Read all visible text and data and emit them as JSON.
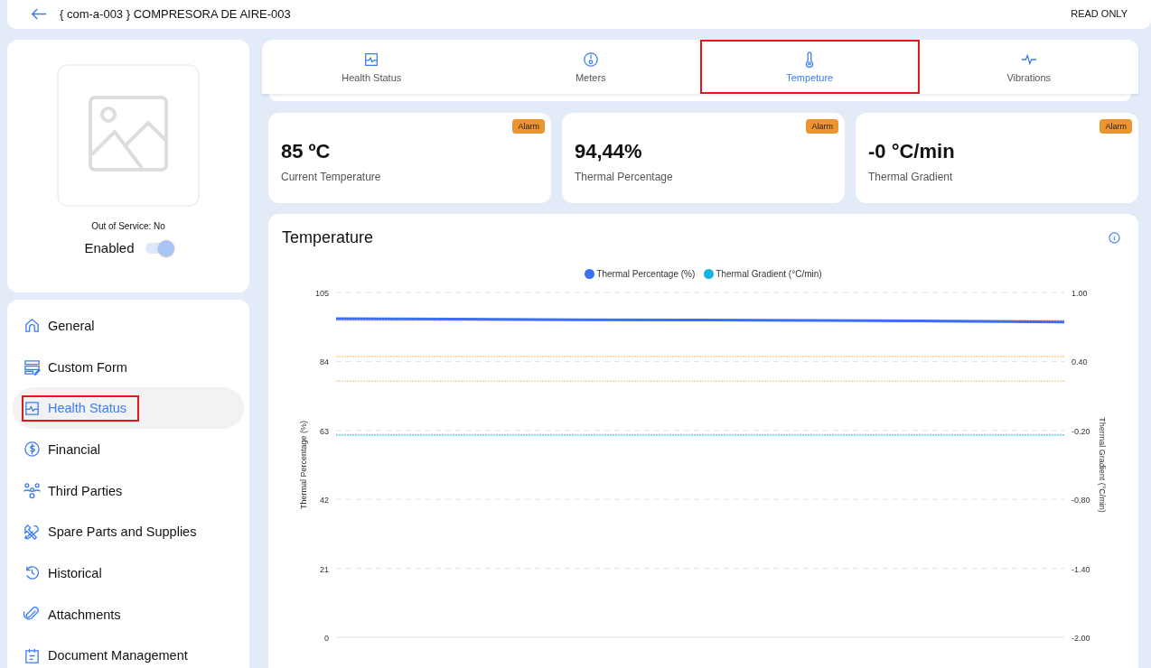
{
  "header": {
    "title": "{ com-a-003 } COMPRESORA DE AIRE-003",
    "mode": "READ ONLY"
  },
  "asset": {
    "out_of_service": "Out of Service: No",
    "enabled": {
      "label": "Enabled",
      "on": true
    }
  },
  "sidebar": {
    "items": [
      {
        "label": "General",
        "selected": false,
        "highlighted": false
      },
      {
        "label": "Custom Form",
        "selected": false,
        "highlighted": false
      },
      {
        "label": "Health Status",
        "selected": true,
        "highlighted": true
      },
      {
        "label": "Financial",
        "selected": false,
        "highlighted": false
      },
      {
        "label": "Third Parties",
        "selected": false,
        "highlighted": false
      },
      {
        "label": "Spare Parts and Supplies",
        "selected": false,
        "highlighted": false
      },
      {
        "label": "Historical",
        "selected": false,
        "highlighted": false
      },
      {
        "label": "Attachments",
        "selected": false,
        "highlighted": false
      },
      {
        "label": "Document Management",
        "selected": false,
        "highlighted": false
      }
    ]
  },
  "tabs": [
    {
      "label": "Health Status",
      "selected": false,
      "highlighted": false
    },
    {
      "label": "Meters",
      "selected": false,
      "highlighted": false
    },
    {
      "label": "Tempeture",
      "selected": true,
      "highlighted": true
    },
    {
      "label": "Vibrations",
      "selected": false,
      "highlighted": false
    }
  ],
  "stats": [
    {
      "value": "85 ºC",
      "label": "Current Temperature",
      "badge": "Alarm"
    },
    {
      "value": "94,44%",
      "label": "Thermal Percentage",
      "badge": "Alarm"
    },
    {
      "value": "-0 °C/min",
      "label": "Thermal Gradient",
      "badge": "Alarm"
    }
  ],
  "chart": {
    "title": "Temperature",
    "chart_data": {
      "type": "line",
      "ylabel": "Thermal Percentage (%)",
      "y2label": "Thermal Gradient (°C/min)",
      "grid": true,
      "legend": "top",
      "series": [
        {
          "name": "Thermal Percentage (%)",
          "color": "#3b6ff5",
          "line_style": "solid",
          "values": [
            97,
            96.9,
            96.7,
            96.6,
            96.5,
            96.3,
            96
          ]
        },
        {
          "name": "Thermal Gradient (°C/min)",
          "color": "#13b5e0",
          "axis": "y2",
          "line_style": "dotted",
          "values": [
            -0.24,
            -0.24,
            -0.24,
            -0.24,
            -0.24,
            -0.24,
            -0.24
          ]
        }
      ],
      "ylim": [
        0,
        105
      ],
      "yticks": [
        0,
        21,
        42,
        63,
        84,
        105
      ],
      "y2lim": [
        -2,
        1
      ],
      "y2ticks": [
        {
          "value": -2,
          "label": "-2.00"
        },
        {
          "value": -1.4,
          "label": "-1.40"
        },
        {
          "value": -0.8,
          "label": "-0.80"
        },
        {
          "value": -0.2,
          "label": "-0.20"
        },
        {
          "value": 0.4,
          "label": "0.40"
        },
        {
          "value": 1,
          "label": "1.00"
        }
      ],
      "ref_lines": [
        {
          "axis": "y",
          "value": 96.5,
          "color": "#f28b82",
          "line_style": "dotted"
        },
        {
          "axis": "y",
          "value": 85.5,
          "color": "#f0b050",
          "line_style": "dotted"
        },
        {
          "axis": "y",
          "value": 78,
          "color": "#f0c070",
          "line_style": "dotted"
        }
      ]
    }
  }
}
